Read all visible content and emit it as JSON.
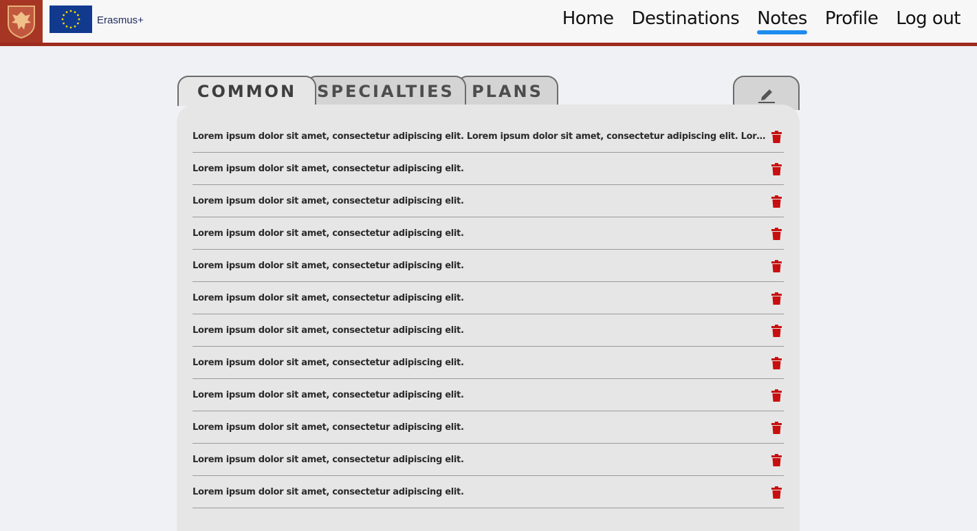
{
  "header": {
    "brand": "Erasmus+",
    "crest_icon": "eagle-crest-icon",
    "flag_icon": "eu-flag-icon",
    "nav": [
      {
        "label": "Home",
        "active": false
      },
      {
        "label": "Destinations",
        "active": false
      },
      {
        "label": "Notes",
        "active": true
      },
      {
        "label": "Profile",
        "active": false
      },
      {
        "label": "Log out",
        "active": false
      }
    ]
  },
  "tabs": [
    {
      "label": "COMMON",
      "active": true
    },
    {
      "label": "SPECIALTIES",
      "active": false
    },
    {
      "label": "PLANS",
      "active": false
    }
  ],
  "edit_icon": "pencil-icon",
  "delete_icon": "trash-icon",
  "notes": [
    "Lorem ipsum dolor sit amet, consectetur adipiscing elit. Lorem ipsum dolor sit amet, consectetur adipiscing elit. Lorem ipsum dolor sit amet, consectetur adipiscing elit.",
    "Lorem ipsum dolor sit amet, consectetur adipiscing elit.",
    "Lorem ipsum dolor sit amet, consectetur adipiscing elit.",
    "Lorem ipsum dolor sit amet, consectetur adipiscing elit.",
    "Lorem ipsum dolor sit amet, consectetur adipiscing elit.",
    "Lorem ipsum dolor sit amet, consectetur adipiscing elit.",
    "Lorem ipsum dolor sit amet, consectetur adipiscing elit.",
    "Lorem ipsum dolor sit amet, consectetur adipiscing elit.",
    "Lorem ipsum dolor sit amet, consectetur adipiscing elit.",
    "Lorem ipsum dolor sit amet, consectetur adipiscing elit.",
    "Lorem ipsum dolor sit amet, consectetur adipiscing elit.",
    "Lorem ipsum dolor sit amet, consectetur adipiscing elit."
  ],
  "colors": {
    "accent_underline": "#1e8cf0",
    "header_border": "#9e2a1d",
    "trash": "#c80f0f"
  }
}
